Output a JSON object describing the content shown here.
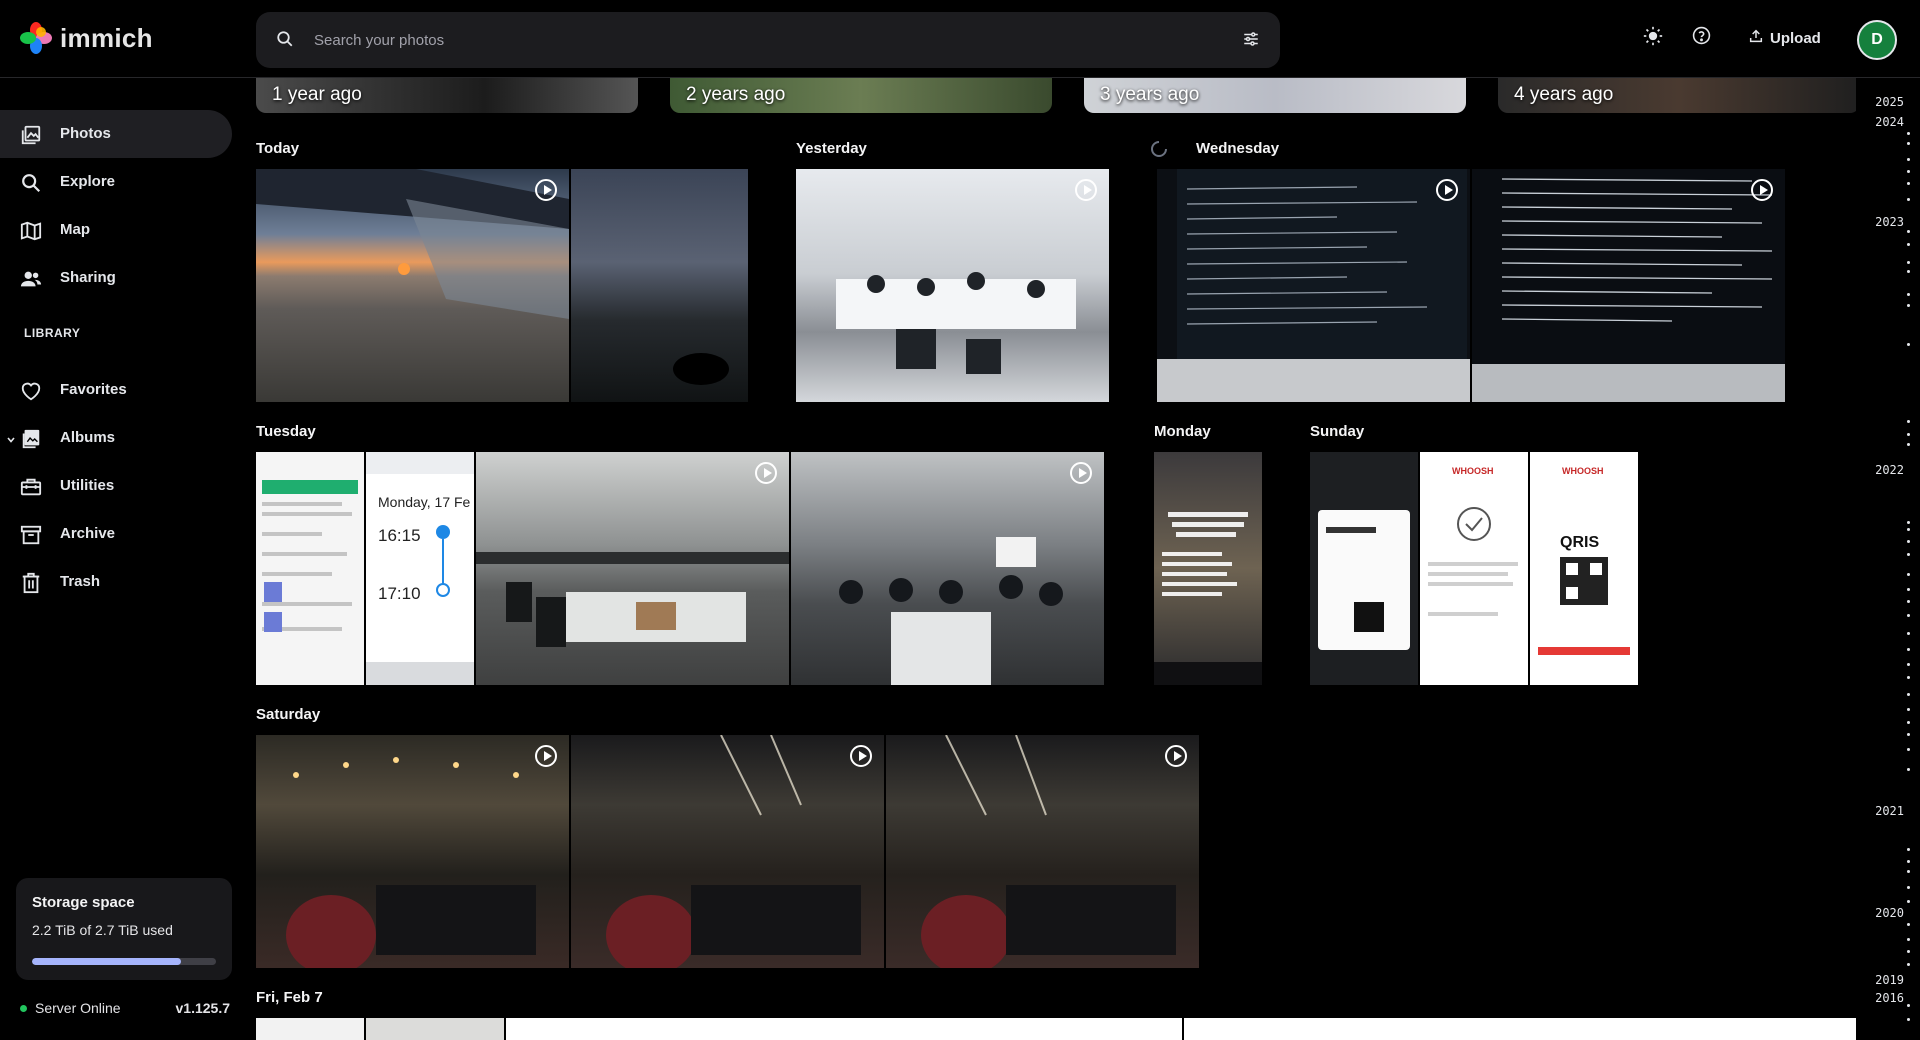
{
  "app": {
    "name": "immich"
  },
  "search": {
    "placeholder": "Search your photos"
  },
  "header": {
    "upload_label": "Upload",
    "avatar_letter": "D"
  },
  "sidebar": {
    "items": [
      {
        "label": "Photos",
        "icon": "photos-icon"
      },
      {
        "label": "Explore",
        "icon": "search-icon"
      },
      {
        "label": "Map",
        "icon": "map-icon"
      },
      {
        "label": "Sharing",
        "icon": "sharing-icon"
      }
    ],
    "library_title": "LIBRARY",
    "library_items": [
      {
        "label": "Favorites",
        "icon": "heart-icon"
      },
      {
        "label": "Albums",
        "icon": "albums-icon"
      },
      {
        "label": "Utilities",
        "icon": "utilities-icon"
      },
      {
        "label": "Archive",
        "icon": "archive-icon"
      },
      {
        "label": "Trash",
        "icon": "trash-icon"
      }
    ],
    "storage": {
      "title": "Storage space",
      "text": "2.2 TiB of 2.7 TiB used",
      "used_fraction": 0.81
    },
    "server": {
      "status": "Server Online",
      "version": "v1.125.7"
    }
  },
  "memories": [
    "1 year ago",
    "2 years ago",
    "3 years ago",
    "4 years ago"
  ],
  "groups": {
    "today": "Today",
    "yesterday": "Yesterday",
    "wednesday": "Wednesday",
    "tuesday": "Tuesday",
    "monday": "Monday",
    "sunday": "Sunday",
    "saturday": "Saturday",
    "feb7": "Fri, Feb 7"
  },
  "thumb_text": {
    "ticket_day": "Monday, 17 Fe",
    "ticket_time1": "16:15",
    "ticket_time2": "17:10",
    "whoosh": "WHOOSH",
    "qris": "QRIS"
  },
  "timeline_years": [
    "2025",
    "2024",
    "2023",
    "2022",
    "2021",
    "2020",
    "2019",
    "2016"
  ],
  "colors": {
    "accent": "#a5b4fc",
    "server_online": "#22c55e",
    "avatar_bg": "#15803d"
  }
}
